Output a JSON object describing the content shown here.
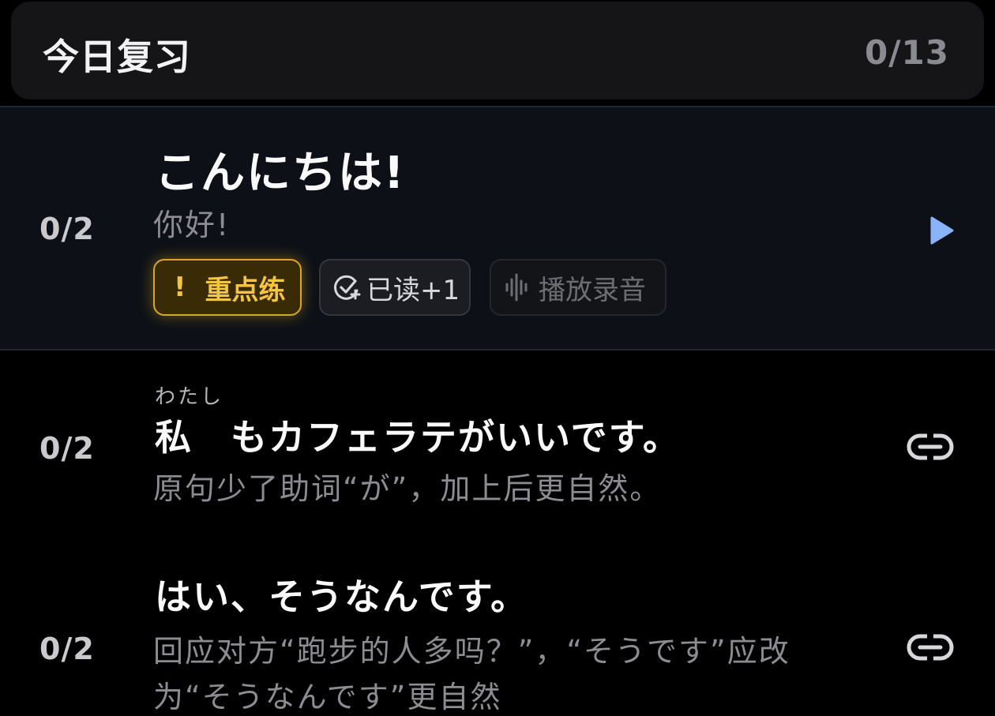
{
  "header": {
    "title": "今日复习",
    "count": "0/13"
  },
  "items": [
    {
      "progress": "0/2",
      "japanese": "こんにちは!",
      "chinese": "你好!",
      "chips": {
        "focus_mark": "!",
        "focus_label": "重点练",
        "read_label": "已读+1",
        "record_label": "播放录音"
      },
      "action_icon": "play-icon"
    },
    {
      "progress": "0/2",
      "ruby": "わたし",
      "japanese": "私　もカフェラテがいいです。",
      "chinese": "原句少了助词“が”，加上后更自然。",
      "action_icon": "link-icon"
    },
    {
      "progress": "0/2",
      "japanese": "はい、そうなんです。",
      "chinese_line1": "回应对方“跑步的人多吗？”，“そうです”应改",
      "chinese_line2": "为“そうなんです”更自然",
      "action_icon": "link-icon"
    }
  ],
  "colors": {
    "background": "#000000",
    "header_bg": "#151518",
    "active_row_bg": "#0d1117",
    "accent_play": "#8ab4f8",
    "focus_chip": "#f5c542"
  }
}
